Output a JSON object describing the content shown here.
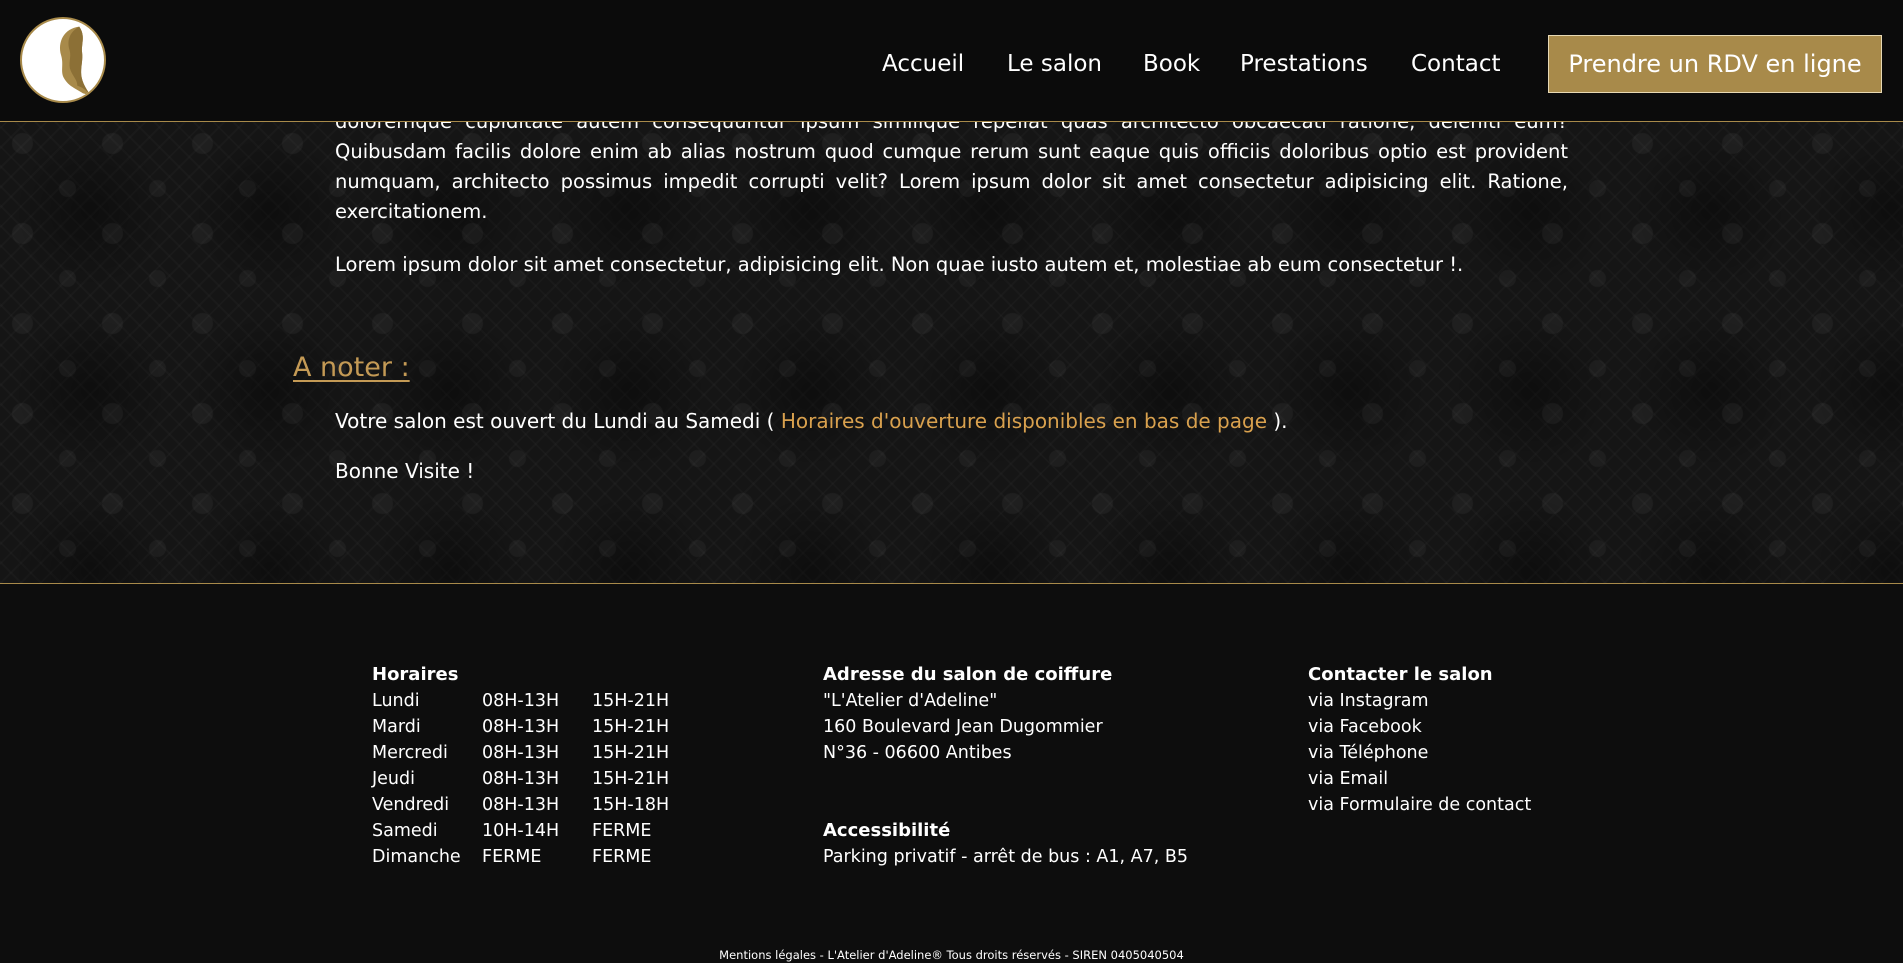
{
  "header": {
    "logo_icon": "woman-profile-logo",
    "nav": [
      "Accueil",
      "Le salon",
      "Book",
      "Prestations",
      "Contact"
    ],
    "cta_label": "Prendre un RDV en ligne",
    "accent_color": "#a88a4a"
  },
  "main": {
    "paragraph1": "doloremque cupiditate autem consequuntur ipsum similique repellat quas architecto obcaecati ratione, deleniti eum? Quibusdam facilis dolore enim ab alias nostrum quod cumque rerum sunt eaque quis officiis doloribus optio est provident numquam, architecto possimus impedit corrupti velit? Lorem ipsum dolor sit amet consectetur adipisicing elit. Ratione, exercitationem.",
    "paragraph2": "Lorem ipsum dolor sit amet consectetur, adipisicing elit. Non quae iusto autem et, molestiae ab eum consectetur !.",
    "note_title": "A noter :",
    "note_prefix": "Votre salon est ouvert du Lundi au Samedi ( ",
    "note_link": "Horaires d'ouverture disponibles en bas de page",
    "note_suffix": " ).",
    "note_bye": "Bonne Visite !"
  },
  "footer": {
    "hours_title": "Horaires",
    "hours": [
      {
        "day": "Lundi",
        "am": "08H-13H",
        "pm": "15H-21H"
      },
      {
        "day": "Mardi",
        "am": "08H-13H",
        "pm": "15H-21H"
      },
      {
        "day": "Mercredi",
        "am": "08H-13H",
        "pm": "15H-21H"
      },
      {
        "day": "Jeudi",
        "am": "08H-13H",
        "pm": "15H-21H"
      },
      {
        "day": "Vendredi",
        "am": "08H-13H",
        "pm": "15H-18H"
      },
      {
        "day": "Samedi",
        "am": "10H-14H",
        "pm": "FERME"
      },
      {
        "day": "Dimanche",
        "am": "FERME",
        "pm": "FERME"
      }
    ],
    "address_title": "Adresse du salon de coiffure",
    "address_lines": [
      "\"L'Atelier d'Adeline\"",
      "160 Boulevard Jean Dugommier",
      "N°36 - 06600 Antibes"
    ],
    "access_title": "Accessibilité",
    "access_text": "Parking privatif - arrêt de bus : A1, A7, B5",
    "contact_title": "Contacter le salon",
    "contact_links": [
      "via Instagram",
      "via Facebook",
      "via Téléphone",
      "via Email",
      "via Formulaire de contact"
    ],
    "legal": "Mentions légales - L'Atelier d'Adeline® Tous droits réservés - SIREN 0405040504"
  }
}
